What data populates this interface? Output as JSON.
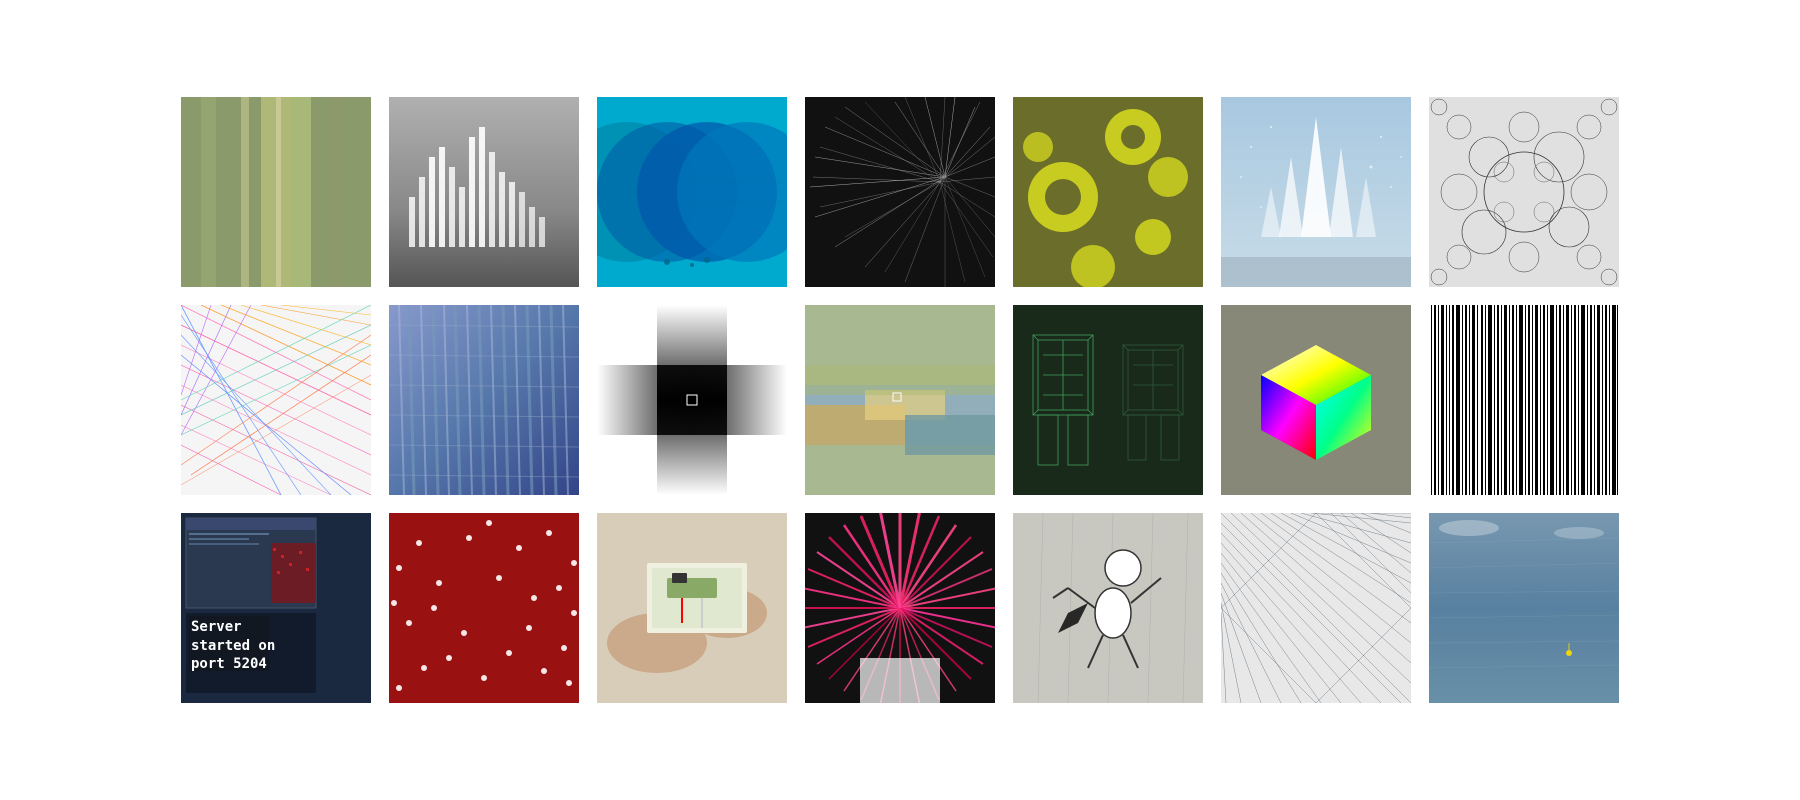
{
  "grid": {
    "rows": 3,
    "cols": 7
  },
  "cells": [
    {
      "id": 0,
      "row": 1,
      "col": 1,
      "type": "color-bands",
      "description": "Vertical olive/sage color bands"
    },
    {
      "id": 1,
      "row": 1,
      "col": 2,
      "type": "3d-bars",
      "description": "3D bar chart in grayscale architectural space"
    },
    {
      "id": 2,
      "row": 1,
      "col": 3,
      "type": "circles",
      "description": "Overlapping blue circles on cyan background"
    },
    {
      "id": 3,
      "row": 1,
      "col": 4,
      "type": "fiber-art",
      "description": "Dark fiber/feather burst pattern"
    },
    {
      "id": 4,
      "row": 1,
      "col": 5,
      "type": "circles-olive",
      "description": "Yellow-green circles on olive background"
    },
    {
      "id": 5,
      "row": 1,
      "col": 6,
      "type": "crystal-sky",
      "description": "Crystal spires against blue sky"
    },
    {
      "id": 6,
      "row": 1,
      "col": 7,
      "type": "bubble-circles",
      "description": "Network of small overlapping circles"
    },
    {
      "id": 7,
      "row": 2,
      "col": 1,
      "type": "string-art",
      "description": "Colorful string art / geometric network"
    },
    {
      "id": 8,
      "row": 2,
      "col": 2,
      "type": "interference",
      "description": "Blue metallic interference pattern"
    },
    {
      "id": 9,
      "row": 2,
      "col": 3,
      "type": "gradient-cross",
      "description": "Black and white gradient cross pattern"
    },
    {
      "id": 10,
      "row": 2,
      "col": 4,
      "type": "aerial-photo",
      "description": "Aerial photo of mineral deposits in water"
    },
    {
      "id": 11,
      "row": 2,
      "col": 5,
      "type": "wireframe",
      "description": "Green wireframe 3D figures"
    },
    {
      "id": 12,
      "row": 2,
      "col": 6,
      "type": "rgb-cube",
      "description": "RGB color cube on gray background"
    },
    {
      "id": 13,
      "row": 2,
      "col": 7,
      "type": "barcode",
      "description": "Black and white barcode pattern"
    },
    {
      "id": 14,
      "row": 3,
      "col": 1,
      "type": "server-screenshot",
      "description": "Screenshot showing server started on port 5204",
      "text": "Server started on port 5204"
    },
    {
      "id": 15,
      "row": 3,
      "col": 2,
      "type": "red-dots",
      "description": "White dots on dark red background"
    },
    {
      "id": 16,
      "row": 3,
      "col": 3,
      "type": "electronics",
      "description": "Hands working with electronics/breadboard"
    },
    {
      "id": 17,
      "row": 3,
      "col": 4,
      "type": "radial-burst",
      "description": "Pink/red radial burst pattern"
    },
    {
      "id": 18,
      "row": 3,
      "col": 5,
      "type": "figure-drawing",
      "description": "Cartoon figure in motion on gray background"
    },
    {
      "id": 19,
      "row": 3,
      "col": 6,
      "type": "network-dark",
      "description": "Dark network/web drawing"
    },
    {
      "id": 20,
      "row": 3,
      "col": 7,
      "type": "ocean",
      "description": "Aerial ocean view with tiny figure"
    }
  ],
  "server_text_line1": "Server",
  "server_text_line2": "started on",
  "server_text_line3": "port 5204"
}
